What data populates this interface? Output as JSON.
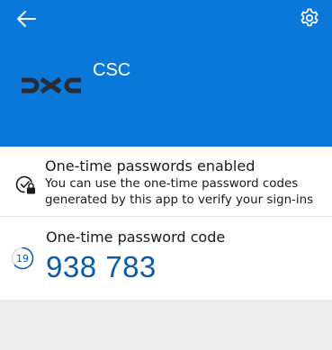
{
  "header": {
    "back_icon": "arrow-left-icon",
    "settings_icon": "gear-icon",
    "account_name": "CSC",
    "logo": "dxc-logo",
    "background": "#0a78d8"
  },
  "status": {
    "icon": "device-lock-check-icon",
    "title": "One-time passwords enabled",
    "description": "You can use the one-time password codes generated by this app to verify your sign-ins"
  },
  "otp": {
    "label": "One-time password code",
    "code": "938 783",
    "seconds_remaining": "19",
    "timer_fraction_remaining": 0.63,
    "accent": "#0a5aa8"
  }
}
